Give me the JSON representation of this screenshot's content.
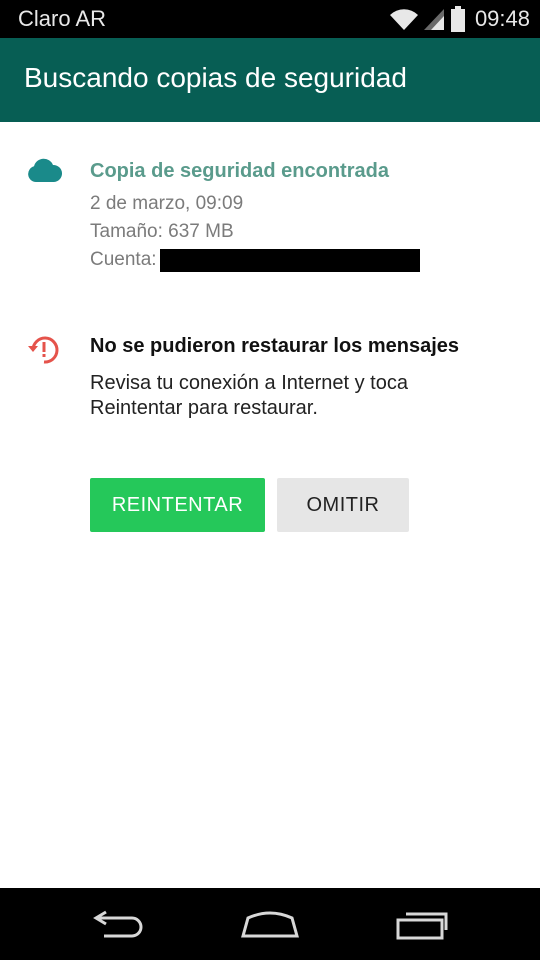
{
  "status_bar": {
    "carrier": "Claro AR",
    "time": "09:48",
    "icons": [
      "wifi-icon",
      "cell-signal-icon",
      "battery-icon"
    ]
  },
  "app_bar": {
    "title": "Buscando copias de seguridad",
    "color": "#075e54"
  },
  "backup": {
    "icon": "cloud-icon",
    "title": "Copia de seguridad encontrada",
    "date": "2 de marzo, 09:09",
    "size": "Tamaño: 637 MB",
    "account_label": "Cuenta:"
  },
  "error": {
    "icon": "restore-error-icon",
    "title": "No se pudieron restaurar los mensajes",
    "message": "Revisa tu conexión a Internet y toca Reintentar para restaurar."
  },
  "actions": {
    "retry_label": "REINTENTAR",
    "skip_label": "OMITIR"
  },
  "colors": {
    "accent_green": "#25c85a",
    "teal_text": "#5a9b8c",
    "error_red": "#e5534b"
  },
  "nav_bar": {
    "icons": [
      "back-icon",
      "home-icon",
      "recents-icon"
    ]
  }
}
